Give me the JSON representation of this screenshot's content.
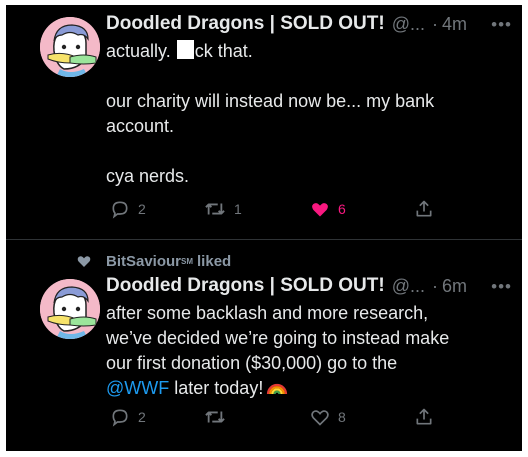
{
  "tweets": [
    {
      "author_name": "Doodled Dragons | SOLD OUT!",
      "handle": "@...",
      "separator": "·",
      "time": "4m",
      "more_label": "•••",
      "line1_before": "actually.",
      "line1_after": "ck that.",
      "para2_line1": "our charity will instead now be... my bank",
      "para2_line2": "account.",
      "para3": "cya nerds.",
      "reply_count": "2",
      "retweet_count": "1",
      "like_count": "6",
      "liked": true
    },
    {
      "social_user": "BitSaviour",
      "social_mark": "SM",
      "social_action": "liked",
      "author_name": "Doodled Dragons | SOLD OUT!",
      "handle": "@...",
      "separator": "·",
      "time": "6m",
      "more_label": "•••",
      "line1": "after some backlash and more research,",
      "line2": "we’ve decided we’re going to instead make",
      "line3": "our first donation ($30,000) go to the",
      "mention": "@WWF",
      "line4_after": "later today!",
      "reply_count": "2",
      "retweet_count": "",
      "like_count": "8",
      "liked": false
    }
  ],
  "colors": {
    "background": "#000000",
    "text": "#e7e9ea",
    "muted": "#71767b",
    "link": "#1d9bf0",
    "like": "#f91880",
    "avatar_bg": "#f4b9c8"
  },
  "icons": [
    "reply-icon",
    "retweet-icon",
    "like-icon",
    "share-icon",
    "more-icon",
    "rainbow-emoji",
    "small-heart-icon"
  ]
}
